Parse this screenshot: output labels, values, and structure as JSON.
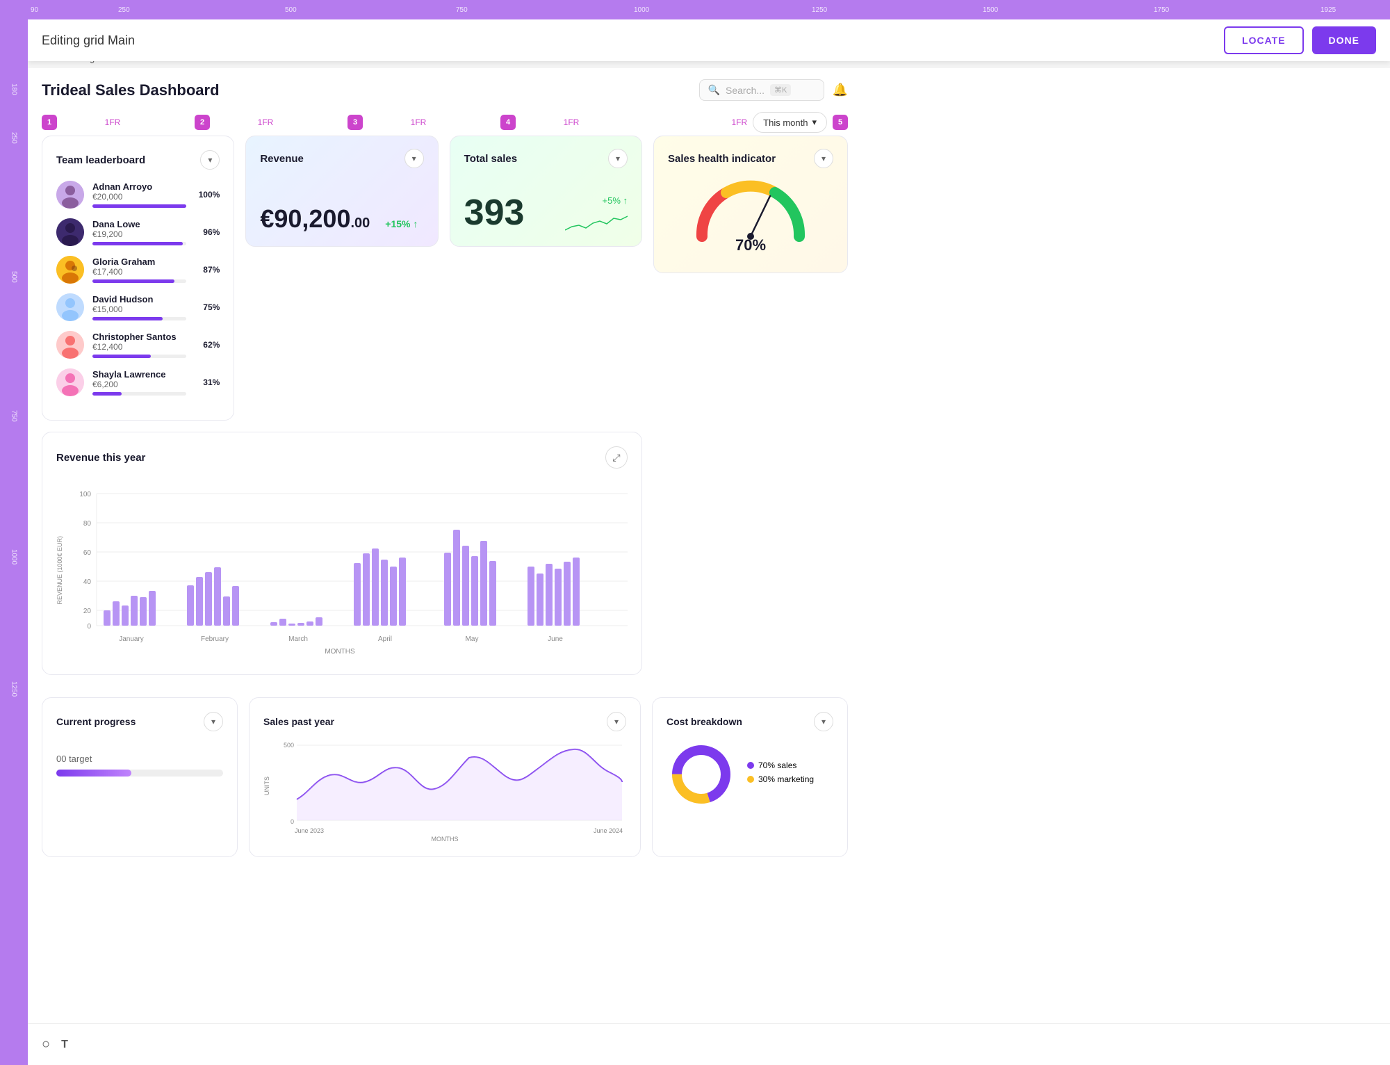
{
  "ruler": {
    "top_ticks": [
      "90",
      "250",
      "500",
      "750",
      "1000",
      "1250",
      "1500",
      "1750",
      "1925"
    ],
    "left_ticks": [
      "180",
      "250",
      "500",
      "750",
      "1000",
      "1250"
    ]
  },
  "editing_bar": {
    "label": "Editing grid Main",
    "locate_btn": "LOCATE",
    "done_btn": "DONE"
  },
  "dashboard_label": "Dashboard light mode",
  "header": {
    "title": "Trideal Sales Dashboard",
    "search_placeholder": "Search...",
    "shortcut": "⌘K"
  },
  "fr_labels": {
    "col1": "1FR",
    "col2": "1FR",
    "col3": "1FR",
    "col4": "1FR"
  },
  "badges": [
    "1",
    "2",
    "3",
    "4",
    "5"
  ],
  "this_month": "This month",
  "kpi_cards": [
    {
      "id": "revenue",
      "title": "Revenue",
      "value": "€90,200",
      "cents": ".00",
      "change": "+15% ↑",
      "type": "revenue"
    },
    {
      "id": "total-sales",
      "title": "Total sales",
      "value": "393",
      "change": "+5% ↑",
      "type": "sales"
    },
    {
      "id": "sales-health",
      "title": "Sales health indicator",
      "value": "70%",
      "type": "health"
    }
  ],
  "leaderboard": {
    "title": "Team leaderboard",
    "members": [
      {
        "name": "Adnan Arroyo",
        "amount": "€20,000",
        "percent": 100,
        "percent_label": "100%",
        "color": "#7c3aed",
        "avatar_bg": "#c084fc",
        "emoji": "👨"
      },
      {
        "name": "Dana Lowe",
        "amount": "€19,200",
        "percent": 96,
        "percent_label": "96%",
        "color": "#7c3aed",
        "avatar_bg": "#4f46e5",
        "emoji": "👩"
      },
      {
        "name": "Gloria Graham",
        "amount": "€17,400",
        "percent": 87,
        "percent_label": "87%",
        "color": "#7c3aed",
        "avatar_bg": "#fbbf24",
        "emoji": "👩‍🦳"
      },
      {
        "name": "David Hudson",
        "amount": "€15,000",
        "percent": 75,
        "percent_label": "75%",
        "color": "#7c3aed",
        "avatar_bg": "#60a5fa",
        "emoji": "👨‍🦱"
      },
      {
        "name": "Christopher Santos",
        "amount": "€12,400",
        "percent": 62,
        "percent_label": "62%",
        "color": "#7c3aed",
        "avatar_bg": "#f87171",
        "emoji": "👨‍🦰"
      },
      {
        "name": "Shayla Lawrence",
        "amount": "€6,200",
        "percent": 31,
        "percent_label": "31%",
        "color": "#7c3aed",
        "avatar_bg": "#f472b6",
        "emoji": "👩‍🦱"
      }
    ]
  },
  "revenue_chart": {
    "title": "Revenue this year",
    "y_label": "REVENUE (1000€ EUR)",
    "x_label": "MONTHS",
    "y_ticks": [
      "0",
      "20",
      "40",
      "60",
      "80",
      "100"
    ],
    "months": [
      "January",
      "February",
      "March",
      "April",
      "May",
      "June"
    ],
    "bars": [
      [
        12,
        18,
        15,
        22,
        20,
        25
      ],
      [
        30,
        35,
        38,
        42,
        20,
        28
      ],
      [
        5,
        8,
        3,
        4,
        6,
        10
      ],
      [
        45,
        52,
        58,
        48,
        40,
        50
      ],
      [
        55,
        75,
        60,
        50,
        62,
        45
      ],
      [
        40,
        35,
        42,
        38,
        44,
        50
      ]
    ]
  },
  "bottom_cards": {
    "current_progress": {
      "title": "Current progress",
      "target_label": "00 target",
      "progress": 45
    },
    "sales_past_year": {
      "title": "Sales past year",
      "x_label": "MONTHS",
      "y_label": "UNITS",
      "start_date": "June 2023",
      "end_date": "June 2024",
      "y_ticks": [
        "0",
        "500"
      ]
    },
    "cost_breakdown": {
      "title": "Cost breakdown",
      "sales_label": "70% sales",
      "marketing_label": "30% marketing",
      "sales_percent": 70,
      "marketing_percent": 30
    }
  },
  "toolbar": {
    "circle_icon": "○",
    "text_icon": "T"
  }
}
